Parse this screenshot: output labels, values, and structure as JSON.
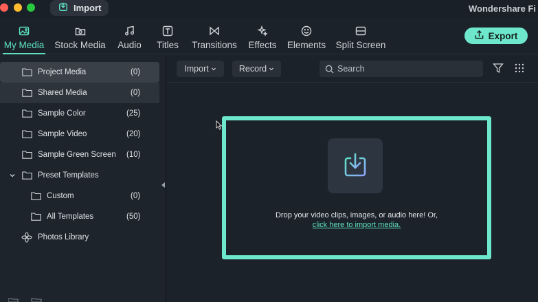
{
  "titlebar": {
    "import_tab_label": "Import",
    "app_title": "Wondershare Fi"
  },
  "toolbar": {
    "tabs": [
      {
        "label": "My Media",
        "icon": "image-icon"
      },
      {
        "label": "Stock Media",
        "icon": "cloud-folder-icon"
      },
      {
        "label": "Audio",
        "icon": "music-note-icon"
      },
      {
        "label": "Titles",
        "icon": "text-box-icon"
      },
      {
        "label": "Transitions",
        "icon": "bowtie-icon"
      },
      {
        "label": "Effects",
        "icon": "sparkle-icon"
      },
      {
        "label": "Elements",
        "icon": "smiley-icon"
      },
      {
        "label": "Split Screen",
        "icon": "split-screen-icon"
      }
    ],
    "active_tab": "My Media",
    "export_label": "Export"
  },
  "sidebar": {
    "items": [
      {
        "label": "Project Media",
        "count": "(0)"
      },
      {
        "label": "Shared Media",
        "count": "(0)"
      },
      {
        "label": "Sample Color",
        "count": "(25)"
      },
      {
        "label": "Sample Video",
        "count": "(20)"
      },
      {
        "label": "Sample Green Screen",
        "count": "(10)"
      },
      {
        "label": "Preset Templates",
        "count": ""
      },
      {
        "label": "Custom",
        "count": "(0)"
      },
      {
        "label": "All Templates",
        "count": "(50)"
      },
      {
        "label": "Photos Library",
        "count": ""
      }
    ]
  },
  "main": {
    "import_dropdown": "Import",
    "record_dropdown": "Record",
    "search_placeholder": "Search",
    "drop_text": "Drop your video clips, images, or audio here! Or,",
    "drop_link": "click here to import media."
  },
  "colors": {
    "accent": "#6ee8cc",
    "background": "#1c222a",
    "sidebar": "#1e242c"
  }
}
